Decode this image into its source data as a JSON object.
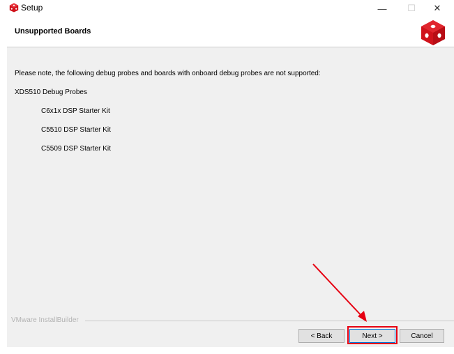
{
  "window": {
    "title": "Setup",
    "controls": {
      "minimize": "—",
      "maximize": "☐",
      "close": "✕"
    },
    "icon": "installer-cube-icon"
  },
  "header": {
    "title": "Unsupported Boards",
    "logo": "installer-cube-logo"
  },
  "content": {
    "note": "Please note, the following debug probes and boards with onboard debug probes are not supported:",
    "group": "XDS510 Debug Probes",
    "boards": [
      "C6x1x DSP Starter Kit",
      "C5510 DSP Starter Kit",
      "C5509 DSP Starter Kit"
    ]
  },
  "footer": {
    "brand": "VMware InstallBuilder",
    "back_label": "< Back",
    "next_label": "Next >",
    "cancel_label": "Cancel"
  },
  "annotation": {
    "color": "#e60012"
  }
}
